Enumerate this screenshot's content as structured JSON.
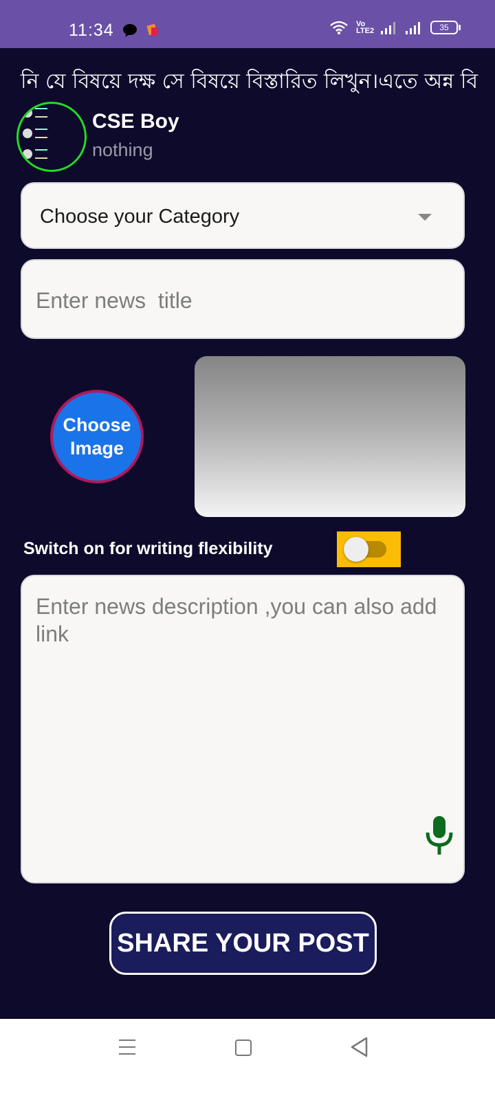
{
  "status_bar": {
    "time": "11:34",
    "battery": "35",
    "network_label": "Vo LTE2",
    "icons": [
      "chat-bubble-icon",
      "app-notification-icon",
      "wifi-icon",
      "volte-icon",
      "signal-icon",
      "signal-icon",
      "battery-icon"
    ]
  },
  "marquee": {
    "text": "নি যে বিষয়ে দক্ষ সে বিষয়ে বিস্তারিত লিখুন।এতে অন্ন বি"
  },
  "user": {
    "name": "CSE Boy",
    "subtitle": "nothing"
  },
  "category": {
    "label": "Choose your Category"
  },
  "title_input": {
    "placeholder": "Enter news  title",
    "value": ""
  },
  "image_picker": {
    "button_label_line1": "Choose",
    "button_label_line2": "Image"
  },
  "flex_switch": {
    "label": "Switch on for writing flexibility",
    "on": false
  },
  "description_input": {
    "placeholder": "Enter news description ,you can also add link",
    "value": ""
  },
  "share_button": {
    "label": "SHARE YOUR POST"
  },
  "colors": {
    "status_bar": "#6a50a7",
    "background": "#0d0a2b",
    "choose_image": "#1a73e8",
    "switch_bg": "#fbbc05",
    "mic": "#0b6b1e",
    "share_button": "#1b1c5c"
  }
}
